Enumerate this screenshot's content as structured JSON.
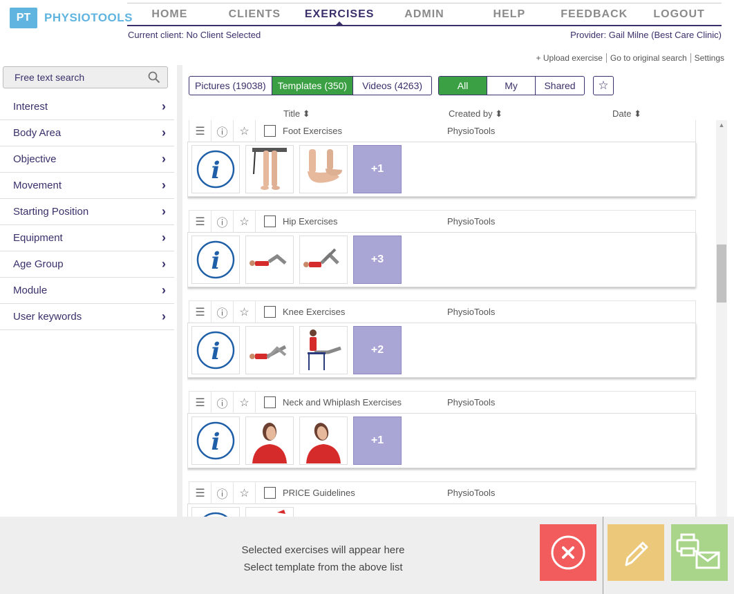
{
  "brand": {
    "initials": "PT",
    "name": "PHYSIOTOOLS"
  },
  "nav": [
    "HOME",
    "CLIENTS",
    "EXERCISES",
    "ADMIN",
    "HELP",
    "FEEDBACK",
    "LOGOUT"
  ],
  "client_text": "Current client: No Client Selected",
  "provider_text": "Provider: Gail Milne (Best Care Clinic)",
  "links": [
    "+ Upload exercise",
    "Go to original search",
    "Settings"
  ],
  "search_placeholder": "Free text search",
  "filters": [
    "Interest",
    "Body Area",
    "Objective",
    "Movement",
    "Starting Position",
    "Equipment",
    "Age Group",
    "Module",
    "User keywords"
  ],
  "media_tabs": [
    "Pictures (19038)",
    "Templates (350)",
    "Videos (4263)"
  ],
  "owner_tabs": [
    "All",
    "My",
    "Shared"
  ],
  "columns": {
    "title": "Title",
    "created": "Created by",
    "date": "Date"
  },
  "templates": [
    {
      "title": "Foot Exercises",
      "creator": "PhysioTools",
      "more": "+1"
    },
    {
      "title": "Hip Exercises",
      "creator": "PhysioTools",
      "more": "+3"
    },
    {
      "title": "Knee Exercises",
      "creator": "PhysioTools",
      "more": "+2"
    },
    {
      "title": "Neck and Whiplash Exercises",
      "creator": "PhysioTools",
      "more": "+1"
    },
    {
      "title": "PRICE Guidelines",
      "creator": "PhysioTools",
      "more": ""
    }
  ],
  "selection": {
    "line1": "Selected exercises will appear here",
    "line2": "Select template from the above list"
  },
  "colors": {
    "brand": "#5fb4e0",
    "primary": "#3b2f6b",
    "active_green": "#3aa043",
    "more_tile": "#a9a5d5",
    "clear": "#f25c5c",
    "edit": "#ecc97a",
    "print": "#a8d58a"
  }
}
